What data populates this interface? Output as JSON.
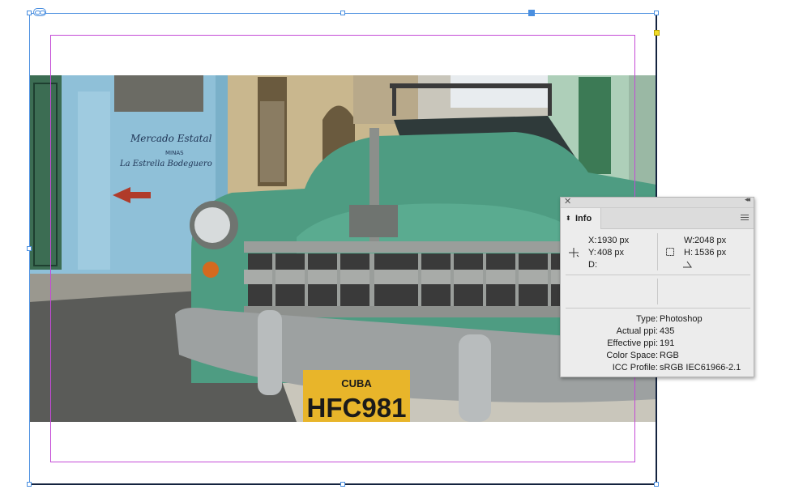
{
  "info_panel": {
    "tab_label": "Info",
    "coords": {
      "x_label": "X:",
      "x_value": "1930 px",
      "y_label": "Y:",
      "y_value": "408 px",
      "d_label": "D:"
    },
    "dims": {
      "w_label": "W:",
      "w_value": "2048 px",
      "h_label": "H:",
      "h_value": "1536 px"
    },
    "file_info": [
      {
        "label": "Type:",
        "value": "Photoshop"
      },
      {
        "label": "Actual ppi:",
        "value": "435"
      },
      {
        "label": "Effective ppi:",
        "value": "191"
      },
      {
        "label": "Color Space:",
        "value": "RGB"
      },
      {
        "label": "ICC Profile:",
        "value": "sRGB IEC61966-2.1"
      }
    ]
  },
  "photo": {
    "license_top": "CUBA",
    "license_plate": "HFC981",
    "wall_sign_line1": "Mercado Estatal",
    "wall_sign_line2": "MINAS",
    "wall_sign_line3": "La Estrella Bodeguero"
  },
  "colors": {
    "selection_blue": "#4a8fe0",
    "margin_guide": "#c44bd6",
    "car_green": "#4e9c82",
    "wall_blue": "#8fc0d8",
    "plate_yellow": "#e8b52a"
  }
}
